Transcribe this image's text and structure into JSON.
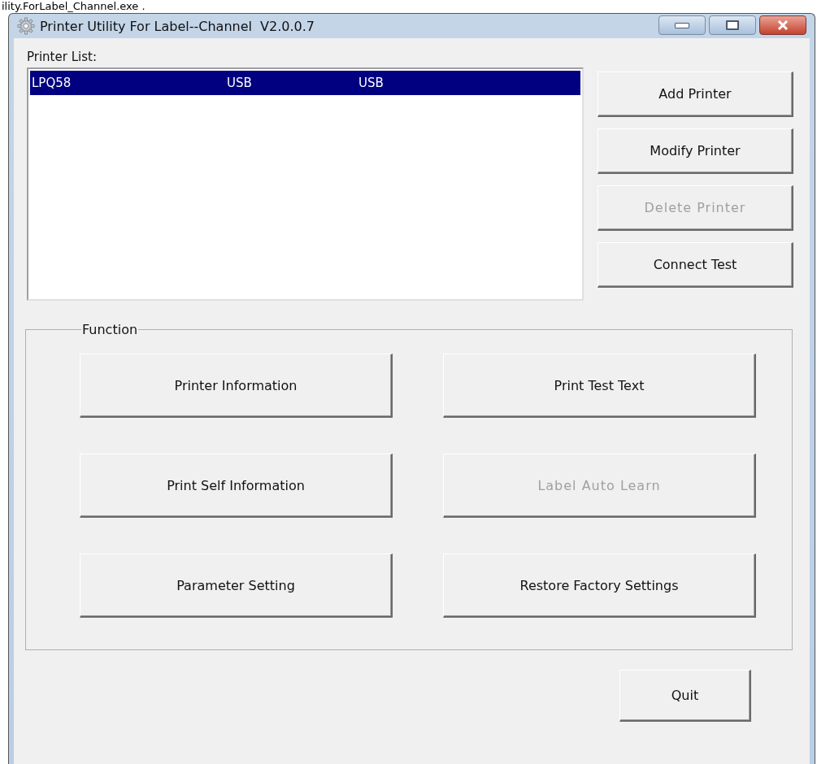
{
  "caption": "ility.ForLabel_Channel.exe .",
  "window": {
    "title": "Printer Utility For Label--Channel  V2.0.0.7"
  },
  "printer_list": {
    "label": "Printer List:",
    "rows": [
      {
        "name": "LPQ58",
        "column_2": "USB",
        "column_3": "USB",
        "selected": true
      }
    ]
  },
  "side_buttons": [
    {
      "label": "Add Printer",
      "disabled": false
    },
    {
      "label": "Modify Printer",
      "disabled": false
    },
    {
      "label": "Delete Printer",
      "disabled": true
    },
    {
      "label": "Connect Test",
      "disabled": false
    }
  ],
  "function_group": {
    "title": "Function",
    "buttons": [
      {
        "label": "Printer Information",
        "disabled": false
      },
      {
        "label": "Print Test Text",
        "disabled": false
      },
      {
        "label": "Print Self Information",
        "disabled": false
      },
      {
        "label": "Label Auto Learn",
        "disabled": true
      },
      {
        "label": "Parameter Setting",
        "disabled": false
      },
      {
        "label": "Restore Factory Settings",
        "disabled": false
      }
    ]
  },
  "quit_button": {
    "label": "Quit"
  }
}
